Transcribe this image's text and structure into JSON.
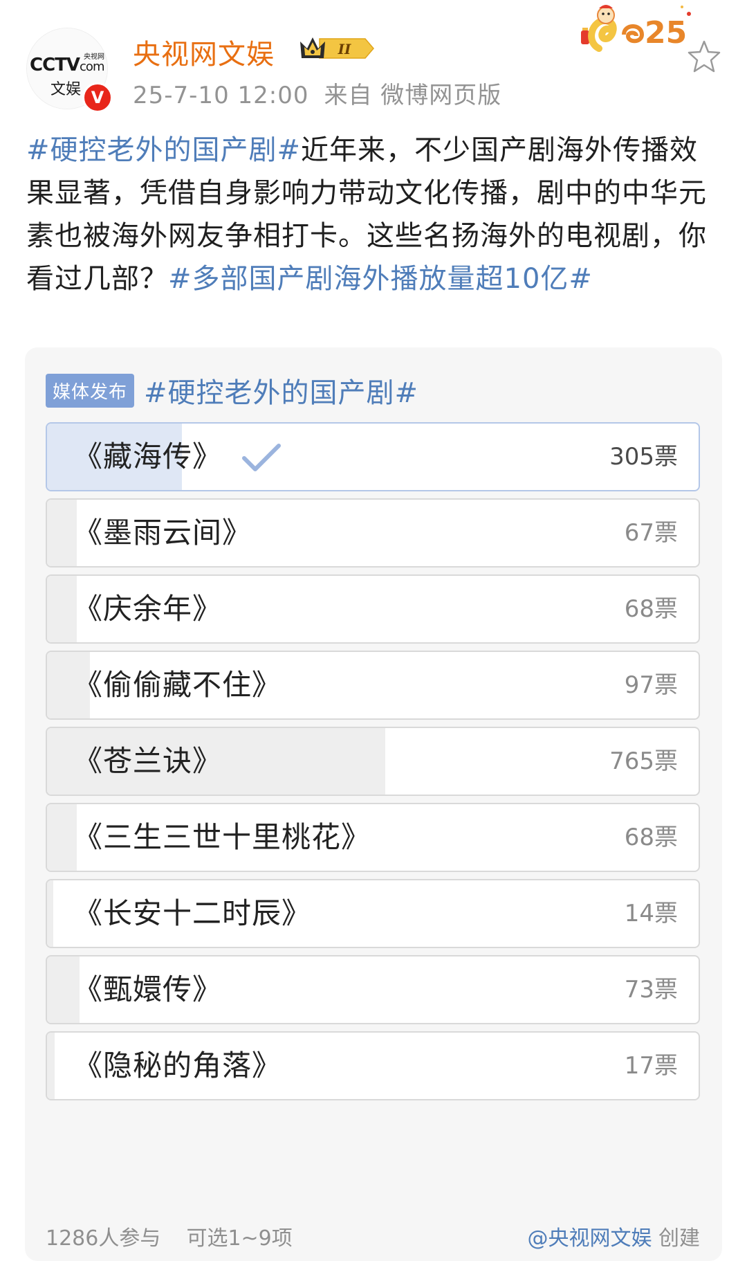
{
  "header": {
    "avatar_brand": "CCTV",
    "avatar_brand_suffix": "com",
    "avatar_brand_small": "央视网",
    "avatar_brand_sub": "文娱",
    "verified_mark": "V",
    "username": "央视网文娱",
    "level_badge": "II",
    "timestamp": "25-7-10 12:00",
    "source": "来自 微博网页版",
    "sticker_text": "25"
  },
  "post": {
    "hashtag1": "#硬控老外的国产剧#",
    "body": "近年来，不少国产剧海外传播效果显著，凭借自身影响力带动文化传播，剧中的中华元素也被海外网友争相打卡。这些名扬海外的电视剧，你看过几部？",
    "hashtag2": "#多部国产剧海外播放量超10亿#"
  },
  "poll": {
    "tag": "媒体发布",
    "topic": "#硬控老外的国产剧#",
    "options": [
      {
        "label": "《藏海传》",
        "votes": "305票",
        "count": 305,
        "selected": true
      },
      {
        "label": "《墨雨云间》",
        "votes": "67票",
        "count": 67,
        "selected": false
      },
      {
        "label": "《庆余年》",
        "votes": "68票",
        "count": 68,
        "selected": false
      },
      {
        "label": "《偷偷藏不住》",
        "votes": "97票",
        "count": 97,
        "selected": false
      },
      {
        "label": "《苍兰诀》",
        "votes": "765票",
        "count": 765,
        "selected": false
      },
      {
        "label": "《三生三世十里桃花》",
        "votes": "68票",
        "count": 68,
        "selected": false
      },
      {
        "label": "《长安十二时辰》",
        "votes": "14票",
        "count": 14,
        "selected": false
      },
      {
        "label": "《甄嬛传》",
        "votes": "73票",
        "count": 73,
        "selected": false
      },
      {
        "label": "《隐秘的角落》",
        "votes": "17票",
        "count": 17,
        "selected": false
      }
    ],
    "participants": "1286人参与",
    "choice_rule": "可选1~9项",
    "creator": "@央视网文娱",
    "created_label": "创建"
  },
  "colors": {
    "username": "#e86f12",
    "hashtag": "#4f7db9",
    "media_tag_bg": "#7fa0d7",
    "selected_fill": "#dfe7f5",
    "option_fill": "#eeeeee",
    "verified": "#e8261a"
  },
  "icons": {
    "crown": "crown-icon",
    "star": "star-icon",
    "check": "check-icon",
    "verified": "verified-icon"
  }
}
